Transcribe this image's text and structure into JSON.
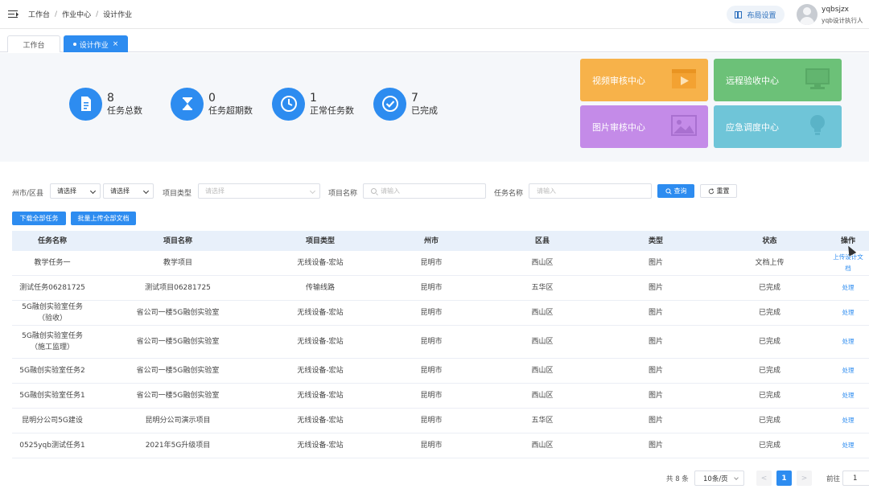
{
  "header": {
    "breadcrumb": [
      "工作台",
      "作业中心",
      "设计作业"
    ],
    "breadcrumb_sep": "/",
    "layout_button": "布局设置",
    "user": {
      "name": "yqbsjzx",
      "role": "yqb设计执行人"
    }
  },
  "tabs": [
    {
      "label": "工作台",
      "active": false
    },
    {
      "label": "设计作业",
      "active": true,
      "close": "×"
    }
  ],
  "stats": [
    {
      "value": "8",
      "label": "任务总数",
      "icon": "document-icon"
    },
    {
      "value": "0",
      "label": "任务超期数",
      "icon": "hourglass-icon"
    },
    {
      "value": "1",
      "label": "正常任务数",
      "icon": "clock-icon"
    },
    {
      "value": "7",
      "label": "已完成",
      "icon": "check-icon"
    }
  ],
  "centers": [
    {
      "label": "视频审核中心",
      "color": "#f7b24a",
      "icon": "video-icon"
    },
    {
      "label": "远程验收中心",
      "color": "#6cc178",
      "icon": "monitor-icon"
    },
    {
      "label": "图片审核中心",
      "color": "#c48be8",
      "icon": "image-icon"
    },
    {
      "label": "应急调度中心",
      "color": "#6fc5d8",
      "icon": "lightbulb-icon"
    }
  ],
  "filters": {
    "region_label": "州市/区县",
    "city_select": "请选择",
    "district_select": "请选择",
    "project_type_label": "项目类型",
    "project_type_placeholder": "请选择",
    "project_name_label": "项目名称",
    "project_name_placeholder": "请输入",
    "task_name_label": "任务名称",
    "task_name_placeholder": "请输入",
    "query_button": "查询",
    "reset_button": "重置"
  },
  "actions": {
    "download_all": "下载全部任务",
    "batch_upload": "批量上传全部文档"
  },
  "table": {
    "columns": [
      "任务名称",
      "项目名称",
      "项目类型",
      "州市",
      "区县",
      "类型",
      "状态",
      "操作"
    ],
    "rows": [
      {
        "task": "教学任务一",
        "project": "教学项目",
        "type": "无线设备-宏站",
        "city": "昆明市",
        "district": "西山区",
        "kind": "图片",
        "status": "文档上传",
        "op": "上传设计文档"
      },
      {
        "task": "测试任务06281725",
        "project": "测试项目06281725",
        "type": "传输线路",
        "city": "昆明市",
        "district": "五华区",
        "kind": "图片",
        "status": "已完成",
        "op": "处理"
      },
      {
        "task": "5G融创实验室任务（验收）",
        "project": "省公司一楼5G融创实验室",
        "type": "无线设备-宏站",
        "city": "昆明市",
        "district": "西山区",
        "kind": "图片",
        "status": "已完成",
        "op": "处理"
      },
      {
        "task": "5G融创实验室任务（施工监理）",
        "project": "省公司一楼5G融创实验室",
        "type": "无线设备-宏站",
        "city": "昆明市",
        "district": "西山区",
        "kind": "图片",
        "status": "已完成",
        "op": "处理"
      },
      {
        "task": "5G融创实验室任务2",
        "project": "省公司一楼5G融创实验室",
        "type": "无线设备-宏站",
        "city": "昆明市",
        "district": "西山区",
        "kind": "图片",
        "status": "已完成",
        "op": "处理"
      },
      {
        "task": "5G融创实验室任务1",
        "project": "省公司一楼5G融创实验室",
        "type": "无线设备-宏站",
        "city": "昆明市",
        "district": "西山区",
        "kind": "图片",
        "status": "已完成",
        "op": "处理"
      },
      {
        "task": "昆明分公司5G建设",
        "project": "昆明分公司演示项目",
        "type": "无线设备-宏站",
        "city": "昆明市",
        "district": "五华区",
        "kind": "图片",
        "status": "已完成",
        "op": "处理"
      },
      {
        "task": "0525yqb测试任务1",
        "project": "2021年5G升级项目",
        "type": "无线设备-宏站",
        "city": "昆明市",
        "district": "西山区",
        "kind": "图片",
        "status": "已完成",
        "op": "处理"
      }
    ]
  },
  "pagination": {
    "total": "共 8 条",
    "page_size": "10条/页",
    "prev": "<",
    "current": "1",
    "next": ">",
    "goto_label": "前往",
    "goto_value": "1"
  }
}
